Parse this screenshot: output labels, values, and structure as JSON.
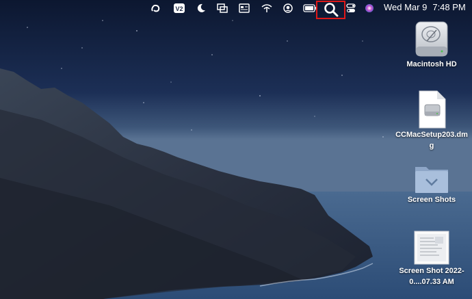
{
  "menubar": {
    "date": "Wed Mar 9",
    "time": "7:48 PM",
    "icons": [
      "creative-cloud-icon",
      "vpn-icon",
      "focus-moon-icon",
      "screen-mirror-icon",
      "menu-app-icon",
      "wifi-icon",
      "user-icon",
      "battery-icon",
      "spotlight-search-icon",
      "control-center-icon",
      "siri-icon"
    ]
  },
  "desktop": {
    "items": [
      {
        "label": "Macintosh HD",
        "icon": "hard-drive-icon"
      },
      {
        "label": "CCMacSetup203.dmg",
        "icon": "dmg-file-icon"
      },
      {
        "label": "Screen Shots",
        "icon": "folder-icon"
      },
      {
        "label": "Screen Shot 2022-0....07.33 AM",
        "icon": "screenshot-thumbnail-icon"
      }
    ]
  },
  "colors": {
    "highlight": "#e01818",
    "sky": "#17284a",
    "sea": "#3a5c85"
  }
}
